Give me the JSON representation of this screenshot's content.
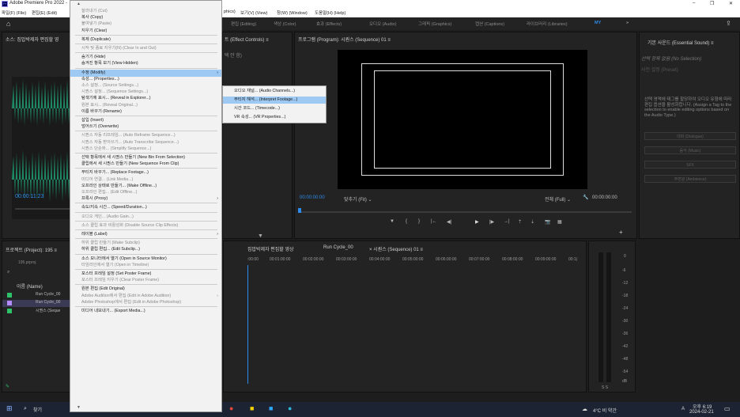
{
  "titlebar": {
    "title": "Adobe Premiere Pro 2022 -",
    "minimize": "–",
    "restore": "❐",
    "close": "✕"
  },
  "menubar": {
    "file": "파일(F) (File)",
    "edit": "편집(E) (Edit)",
    "graphics": "phics)",
    "view": "보기(V) (View)",
    "window": "창(W) (Window)",
    "help": "도움말(H) (Help)"
  },
  "workspaces": {
    "editing": "편집 (Editing)",
    "color": "색상 (Color)",
    "effects": "효과 (Effects)",
    "audio": "오디오 (Audio)",
    "graphics": "그래픽 (Graphics)",
    "captions": "캡션 (Captions)",
    "libraries": "라이브러리 (Libraries)",
    "my": "MY",
    "more": "»"
  },
  "source_panel": {
    "title": "소스: 집밥박제자 편집할 영",
    "timecode": "00:00:11:23"
  },
  "effect_controls": {
    "title": "트 (Effect Controls) ≡",
    "sub": "택 안 함)"
  },
  "program": {
    "title": "프로그램 (Program): 시퀀스 (Sequence) 01 ≡",
    "timecode": "00:00:00:00",
    "fit": "맞추기 (Fit) ⌄",
    "full": "전체 (Full) ⌄",
    "duration": "00:00:00:00"
  },
  "essential_sound": {
    "title": "기본 사운드 (Essential Sound) ≡",
    "no_selection": "선택 항목 없음 (No Selection)",
    "preset": "사전 설정 (Preset)",
    "desc": "선택 영역에 태그를 할당하여 오디오 유형에 따라 편집 옵션을 활성화합니다. (Assign a Tag to the selection to enable editing options based on the Audio Type.)",
    "dialogue": "대화 (Dialogue)",
    "music": "음악 (Music)",
    "sfx": "SFX",
    "ambience": "주변광 (Ambience)"
  },
  "project": {
    "title": "프로젝트 (Project): 195 ≡",
    "items_count": "195.prproj",
    "col_name": "이름 (Name)",
    "rows": [
      "Run Cycle_00",
      "Run Cycle_00",
      "시퀀스 (Seque"
    ]
  },
  "timeline": {
    "tab1": "집밥박제자 편집할 영상",
    "tab2": "Run Cycle_00",
    "tab3": "× 시퀀스 (Sequence) 01 ≡",
    "ruler": [
      ":00:00",
      "00:01:00:00",
      "00:02:00:00",
      "00:03:00:00",
      "00:04:00:00",
      "00:05:00:00",
      "00:06:00:00",
      "00:07:00:00",
      "00:08:00:00",
      "00:09:00:00",
      "00:1("
    ]
  },
  "meter_scale": [
    "0",
    "-6",
    "-12",
    "-18",
    "-24",
    "-30",
    "-36",
    "-42",
    "-48",
    "-54",
    "dB"
  ],
  "meter_solo": "S  S",
  "context_menu": [
    {
      "label": "잘라내기 (Cut)",
      "disabled": true
    },
    {
      "label": "복사 (Copy)",
      "disabled": false
    },
    {
      "label": "붙여넣기 (Paste)",
      "disabled": true
    },
    {
      "label": "지우기 (Clear)",
      "disabled": false
    },
    {
      "sep": true
    },
    {
      "label": "복제 (Duplicate)",
      "disabled": false
    },
    {
      "sep": true
    },
    {
      "label": "시작 및 종료 지우기(N) (Clear In and Out)",
      "disabled": true
    },
    {
      "sep": true
    },
    {
      "label": "숨기기 (Hide)",
      "disabled": false
    },
    {
      "label": "숨겨진 항목 보기 (View Hidden)",
      "disabled": false
    },
    {
      "sep": true
    },
    {
      "label": "수정 (Modify)",
      "disabled": false,
      "highlight": true,
      "submenu": true
    },
    {
      "label": "속성... (Properties...)",
      "disabled": false
    },
    {
      "label": "소스 설정... (Source Settings...)",
      "disabled": true
    },
    {
      "label": "시퀀스 설정... (Sequence Settings...)",
      "disabled": true
    },
    {
      "label": "탐색기에 표시... (Reveal in Explorer...)",
      "disabled": false
    },
    {
      "label": "원본 표시... (Reveal Original...)",
      "disabled": true
    },
    {
      "label": "이름 바꾸기 (Rename)",
      "disabled": false
    },
    {
      "sep": true
    },
    {
      "label": "삽입 (Insert)",
      "disabled": false
    },
    {
      "label": "덮어쓰기 (Overwrite)",
      "disabled": false
    },
    {
      "sep": true
    },
    {
      "label": "시퀀스 자동 리프레임... (Auto Reframe Sequence...)",
      "disabled": true
    },
    {
      "label": "시퀀스 자동 받아쓰기... (Auto Transcribe Sequence...)",
      "disabled": true
    },
    {
      "label": "시퀀스 단순화... (Simplify Sequence...)",
      "disabled": true
    },
    {
      "sep": true
    },
    {
      "label": "선택 항목에서 새 시퀀스 만들기 (New Bin From Selection)",
      "disabled": false
    },
    {
      "label": "클립에서 새 시퀀스 만들기 (New Sequence From Clip)",
      "disabled": false
    },
    {
      "sep": true
    },
    {
      "label": "푸티지 바꾸기... (Replace Footage...)",
      "disabled": false
    },
    {
      "label": "미디어 연결... (Link Media...)",
      "disabled": true
    },
    {
      "label": "오프라인 상태로 만들기... (Make Offline...)",
      "disabled": false
    },
    {
      "label": "오프라인 편집... (Edit Offline...)",
      "disabled": true
    },
    {
      "label": "프록시 (Proxy)",
      "disabled": false,
      "submenu": true
    },
    {
      "sep": true
    },
    {
      "label": "속도/지속 시간... (Speed/Duration...)",
      "disabled": false
    },
    {
      "sep": true
    },
    {
      "label": "오디오 게인... (Audio Gain...)",
      "disabled": true
    },
    {
      "sep": true
    },
    {
      "label": "소스 클립 효과 비활성화 (Disable Source Clip Effects)",
      "disabled": true
    },
    {
      "sep": true
    },
    {
      "label": "레이블 (Label)",
      "disabled": false,
      "submenu": true
    },
    {
      "sep": true
    },
    {
      "label": "하위 클립 만들기 (Make Subclip)",
      "disabled": true
    },
    {
      "label": "하위 클립 편집... (Edit Subclip...)",
      "disabled": false
    },
    {
      "sep": true
    },
    {
      "label": "소스 모니터에서 열기 (Open in Source Monitor)",
      "disabled": false
    },
    {
      "label": "타임라인에서 열기 (Open in Timeline)",
      "disabled": true
    },
    {
      "sep": true
    },
    {
      "label": "포스터 프레임 설정 (Set Poster Frame)",
      "disabled": false
    },
    {
      "label": "포스터 프레임 지우기 (Clear Poster Frame)",
      "disabled": true
    },
    {
      "sep": true
    },
    {
      "label": "원본 편집 (Edit Original)",
      "disabled": false
    },
    {
      "label": "Adobe Audition에서 편집 (Edit in Adobe Audition)",
      "disabled": true,
      "submenu": true
    },
    {
      "label": "Adobe Photoshop에서 편집 (Edit in Adobe Photoshop)",
      "disabled": true
    },
    {
      "sep": true
    },
    {
      "label": "미디어 내보내기... (Export Media...)",
      "disabled": false
    }
  ],
  "submenu": [
    {
      "label": "오디오 채널... (Audio Channels...)",
      "highlight": false
    },
    {
      "label": "푸티지 해석... (Interpret Footage...)",
      "highlight": true
    },
    {
      "label": "시간 코드... (Timecode...)",
      "highlight": false
    },
    {
      "label": "VR 속성... (VR Properties...)",
      "highlight": false
    }
  ],
  "taskbar": {
    "search": "찾기",
    "weather": "4°C 비 약간",
    "time": "오후 6:19",
    "date": "2024-02-21",
    "lang": "A"
  },
  "colors": {
    "accent_blue": "#2d8ceb",
    "menu_highlight": "#9dc9f2",
    "waveform": "#1e8a66"
  }
}
